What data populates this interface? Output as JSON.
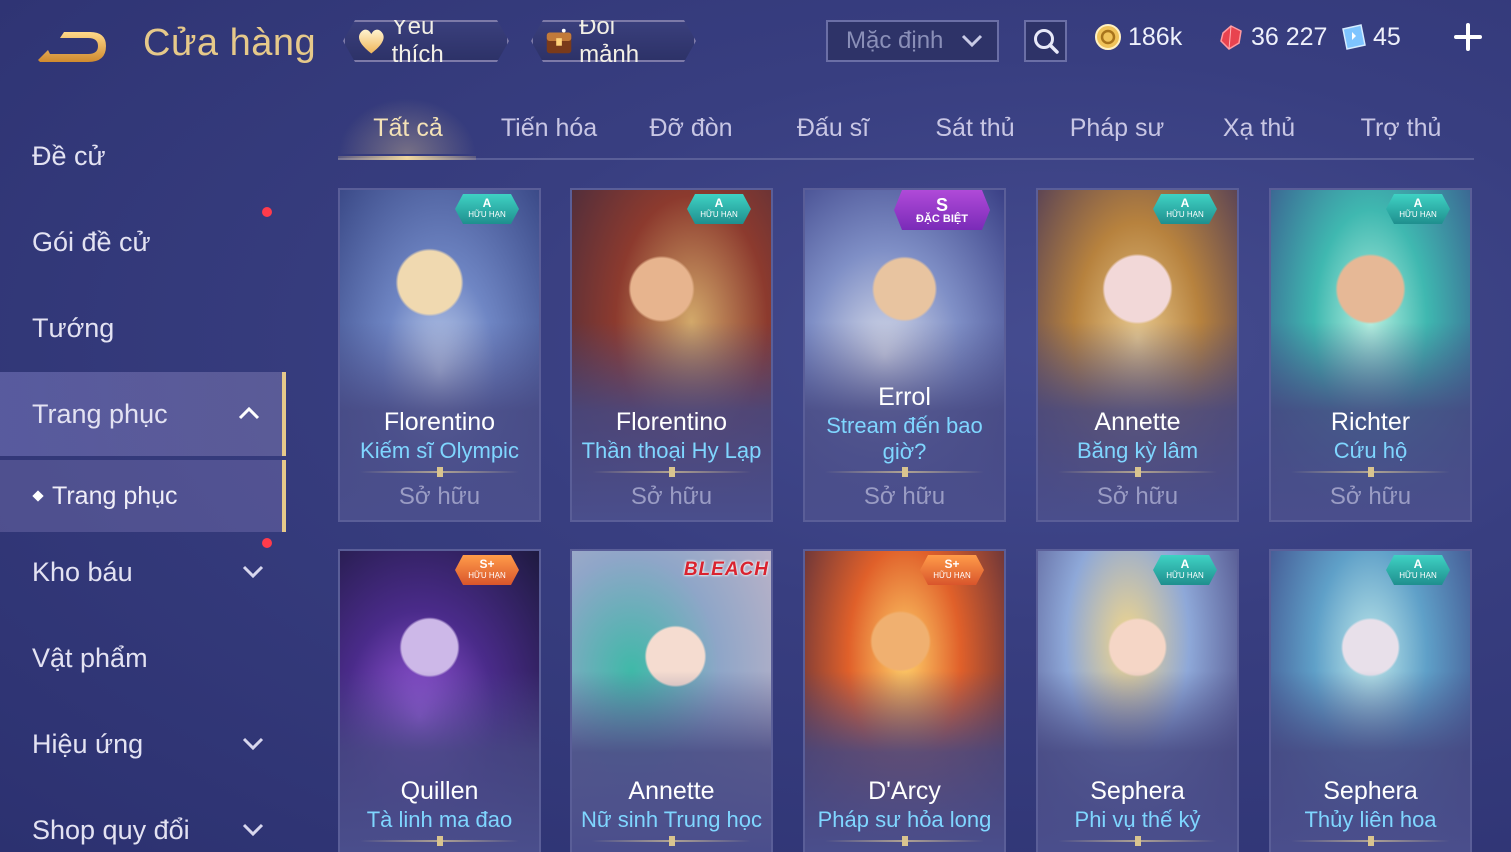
{
  "header": {
    "title": "Cửa hàng",
    "favorite_label": "Yêu thích",
    "shard_label": "Đổi mảnh",
    "sort_value": "Mặc định",
    "gold": "186k",
    "gems": "36 227",
    "vouchers": "45"
  },
  "sidebar": {
    "items": [
      {
        "label": "Đề cử"
      },
      {
        "label": "Gói đề cử"
      },
      {
        "label": "Tướng"
      },
      {
        "label": "Trang phục"
      },
      {
        "label": "Trang phục"
      },
      {
        "label": "Kho báu"
      },
      {
        "label": "Vật phẩm"
      },
      {
        "label": "Hiệu ứng"
      },
      {
        "label": "Shop quy đổi"
      }
    ]
  },
  "tabs": [
    "Tất cả",
    "Tiến hóa",
    "Đỡ đòn",
    "Đấu sĩ",
    "Sát thủ",
    "Pháp sư",
    "Xạ thủ",
    "Trợ thủ"
  ],
  "badges": {
    "a": {
      "rank": "A",
      "text": "HỮU HẠN"
    },
    "splus": {
      "rank": "S+",
      "text": "HỮU HẠN"
    },
    "s": {
      "rank": "S",
      "text": "ĐẶC BIỆT"
    },
    "bleach": "BLEACH"
  },
  "cards": [
    {
      "hero": "Florentino",
      "skin": "Kiếm sĩ Olympic",
      "status": "Sở hữu"
    },
    {
      "hero": "Florentino",
      "skin": "Thần thoại Hy Lạp",
      "status": "Sở hữu"
    },
    {
      "hero": "Errol",
      "skin": "Stream đến bao giờ?",
      "status": "Sở hữu"
    },
    {
      "hero": "Annette",
      "skin": "Băng kỳ lâm",
      "status": "Sở hữu"
    },
    {
      "hero": "Richter",
      "skin": "Cứu hộ",
      "status": "Sở hữu"
    },
    {
      "hero": "Quillen",
      "skin": "Tà linh ma đao"
    },
    {
      "hero": "Annette",
      "skin": "Nữ sinh Trung học"
    },
    {
      "hero": "D'Arcy",
      "skin": "Pháp sư hỏa long"
    },
    {
      "hero": "Sephera",
      "skin": "Phi vụ thế kỷ"
    },
    {
      "hero": "Sephera",
      "skin": "Thủy liên hoa"
    }
  ],
  "colors": {
    "accent_gold": "#e6c98a",
    "skin_name": "#7fd6ff",
    "notification_dot": "#ff3b4b"
  }
}
